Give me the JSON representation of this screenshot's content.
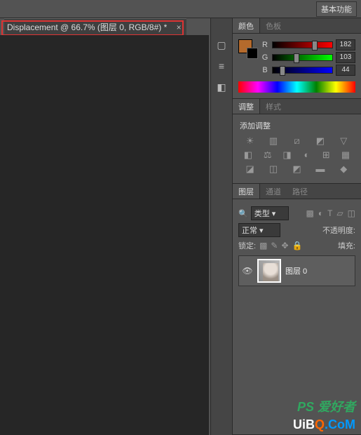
{
  "topbar": {
    "preset_label": "基本功能"
  },
  "tab": {
    "title": "Displacement @ 66.7% (图层 0, RGB/8#) *",
    "close": "×"
  },
  "color_panel": {
    "tab_color": "颜色",
    "tab_swatches": "色板",
    "r_label": "R",
    "g_label": "G",
    "b_label": "B",
    "r_value": "182",
    "g_value": "103",
    "b_value": "44",
    "swatch_hex": "#b46a2c"
  },
  "adjust_panel": {
    "tab_adjust": "调整",
    "tab_styles": "样式",
    "title": "添加调整"
  },
  "layers_panel": {
    "tab_layers": "图层",
    "tab_channels": "通道",
    "tab_paths": "路径",
    "kind_label": "类型",
    "search_icon": "🔍",
    "blend_mode": "正常",
    "opacity_label": "不透明度:",
    "lock_label": "锁定:",
    "fill_label": "填充:",
    "layer0_name": "图层 0"
  },
  "watermark": {
    "ps": "PS 爱好者",
    "site1": "UiB",
    "site2": "Q",
    "site3": ".CoM"
  }
}
